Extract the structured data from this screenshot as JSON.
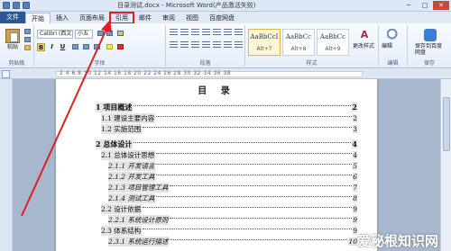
{
  "window": {
    "title": "目录测试.docx - Microsoft Word(产品激活失败)",
    "minimize": "─",
    "maximize": "□",
    "close": "✕"
  },
  "tabs": [
    {
      "label": "文件"
    },
    {
      "label": "开始"
    },
    {
      "label": "插入"
    },
    {
      "label": "页面布局"
    },
    {
      "label": "引用"
    },
    {
      "label": "邮件"
    },
    {
      "label": "审阅"
    },
    {
      "label": "视图"
    },
    {
      "label": "百度网盘"
    }
  ],
  "ribbon": {
    "clipboard": {
      "group": "剪贴板",
      "paste": "粘贴"
    },
    "font": {
      "group": "字体",
      "name": "Calibri (西文)",
      "size": "小五",
      "bold": "B",
      "italic": "I",
      "underline": "U"
    },
    "paragraph": {
      "group": "段落"
    },
    "styles": {
      "group": "样式",
      "items": [
        {
          "preview": "AaBbCcI",
          "key": "Alt+7"
        },
        {
          "preview": "AaBbCc",
          "key": "Alt+8"
        },
        {
          "preview": "AaBbCc",
          "key": "Alt+9"
        }
      ],
      "change": "更改样式"
    },
    "editing": {
      "group": "编辑",
      "label": "编辑"
    },
    "save": {
      "group": "保存",
      "label": "保存到百度网盘"
    }
  },
  "ruler": {
    "numbers": "2   4   6   8   10   12   14   16   18   20   22   24   26   28   30   32   34   36   38"
  },
  "document": {
    "toc_title": "目 录",
    "entries": [
      {
        "level": 1,
        "text": "1 项目概述",
        "page": "2"
      },
      {
        "level": 2,
        "text": "1.1 建设主要内容",
        "page": "2"
      },
      {
        "level": 2,
        "text": "1.2 实施范围",
        "page": "3"
      },
      {
        "level": 1,
        "text": "2 总体设计",
        "page": "4"
      },
      {
        "level": 2,
        "text": "2.1 总体设计思想",
        "page": "4"
      },
      {
        "level": 3,
        "text": "2.1.1 开发语言",
        "page": "5"
      },
      {
        "level": 3,
        "text": "2.1.2 开发工具",
        "page": "6"
      },
      {
        "level": 3,
        "text": "2.1.3 项目管理工具",
        "page": "7"
      },
      {
        "level": 3,
        "text": "2.1.4 测试工具",
        "page": "8"
      },
      {
        "level": 2,
        "text": "2.2 设计依据",
        "page": "9"
      },
      {
        "level": 3,
        "text": "2.2.1 系统设计原则",
        "page": "9"
      },
      {
        "level": 2,
        "text": "2.3 体系结构",
        "page": "9"
      },
      {
        "level": 3,
        "text": "2.3.1 系统运行描述",
        "page": "10"
      }
    ]
  },
  "watermark": "爱秘根知识网",
  "colors": {
    "annotation": "#e02020",
    "file_tab": "#2b5797"
  }
}
